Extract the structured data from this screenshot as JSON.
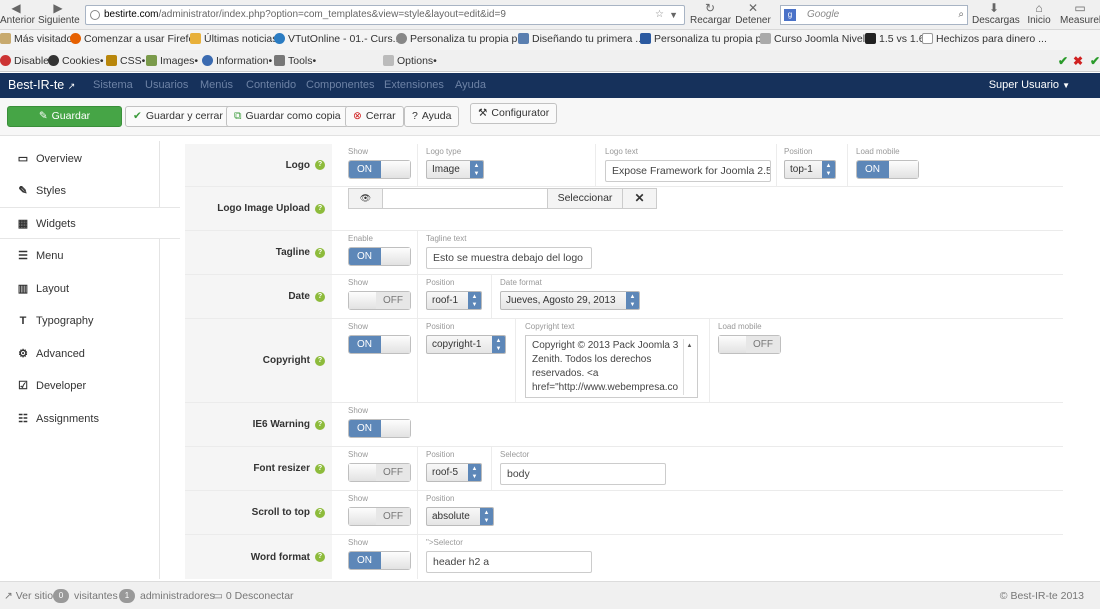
{
  "browser": {
    "back_label": "Anterior",
    "forward_label": "Siguiente",
    "url_host": "bestirte.com",
    "url_path": "/administrator/index.php?option=com_templates&view=style&layout=edit&id=9",
    "reload_label": "Recargar",
    "stop_label": "Detener",
    "search_engine": "Google",
    "downloads_label": "Descargas",
    "home_label": "Inicio",
    "measure_label": "Measurel"
  },
  "bookmarks": [
    "Más visitados",
    "Comenzar a usar Firefox",
    "Últimas noticias",
    "VTutOnline - 01.- Curs...",
    "Personaliza tu propia p...",
    "Diseñando tu primera ...",
    "Personaliza tu propia p...",
    "Curso Joomla Nivel 1",
    "1.5 vs 1.6",
    "Hechizos para dinero ..."
  ],
  "webdev_toolbar": [
    "Disable•",
    "Cookies•",
    "CSS•",
    "Images•",
    "Information•",
    "Tools•",
    "Options•"
  ],
  "admin_bar": {
    "brand": "Best-IR-te",
    "menu": [
      "Sistema",
      "Usuarios",
      "Menús",
      "Contenido",
      "Componentes",
      "Extensiones",
      "Ayuda"
    ],
    "user": "Super Usuario"
  },
  "toolbar": {
    "save": "Guardar",
    "save_close": "Guardar y cerrar",
    "save_copy": "Guardar como copia",
    "close": "Cerrar",
    "help": "Ayuda",
    "configurator": "Configurator"
  },
  "sidebar": [
    "Overview",
    "Styles",
    "Widgets",
    "Menu",
    "Layout",
    "Typography",
    "Advanced",
    "Developer",
    "Assignments"
  ],
  "fields": {
    "logo": {
      "label": "Logo",
      "cap_show": "Show",
      "show": "ON",
      "cap_type": "Logo type",
      "type": "Image",
      "cap_text": "Logo text",
      "text": "Expose Framework for Joomla 2.5",
      "cap_position": "Position",
      "position": "top-1",
      "cap_mobile": "Load mobile",
      "mobile": "ON"
    },
    "logo_upload": {
      "label": "Logo Image Upload",
      "button": "Seleccionar"
    },
    "tagline": {
      "label": "Tagline",
      "cap_enable": "Enable",
      "enable": "ON",
      "cap_text": "Tagline text",
      "text": "Esto se muestra debajo del logo"
    },
    "date": {
      "label": "Date",
      "cap_show": "Show",
      "show": "OFF",
      "cap_position": "Position",
      "position": "roof-1",
      "cap_format": "Date format",
      "format": "Jueves, Agosto 29, 2013"
    },
    "copyright": {
      "label": "Copyright",
      "cap_show": "Show",
      "show": "ON",
      "cap_position": "Position",
      "position": "copyright-1",
      "cap_text": "Copyright text",
      "text": "Copyright © 2013 Pack Joomla 3 Zenith. Todos los derechos reservados. <a href=\"http://www.webempresa.co",
      "cap_mobile": "Load mobile",
      "mobile": "OFF"
    },
    "ie6": {
      "label": "IE6 Warning",
      "cap_show": "Show",
      "show": "ON"
    },
    "font_resizer": {
      "label": "Font resizer",
      "cap_show": "Show",
      "show": "OFF",
      "cap_position": "Position",
      "position": "roof-5",
      "cap_selector": "Selector",
      "selector": "body"
    },
    "scroll_top": {
      "label": "Scroll to top",
      "cap_show": "Show",
      "show": "OFF",
      "cap_position": "Position",
      "position": "absolute"
    },
    "word_format": {
      "label": "Word format",
      "cap_show": "Show",
      "show": "ON",
      "cap_selector": "\">Selector",
      "selector": "header h2 a"
    }
  },
  "footer": {
    "site": "Ver sitio",
    "visitors_count": "0",
    "visitors": "visitantes",
    "admins_count": "1",
    "admins": "administradores",
    "logout_count": "0",
    "logout": "Desconectar",
    "copyright": "© Best-IR-te 2013"
  },
  "colors": {
    "admin_bar": "#16315b",
    "save_green": "#46a546",
    "toggle_on": "#5d87b8",
    "help_icon": "#8dbb3b"
  }
}
